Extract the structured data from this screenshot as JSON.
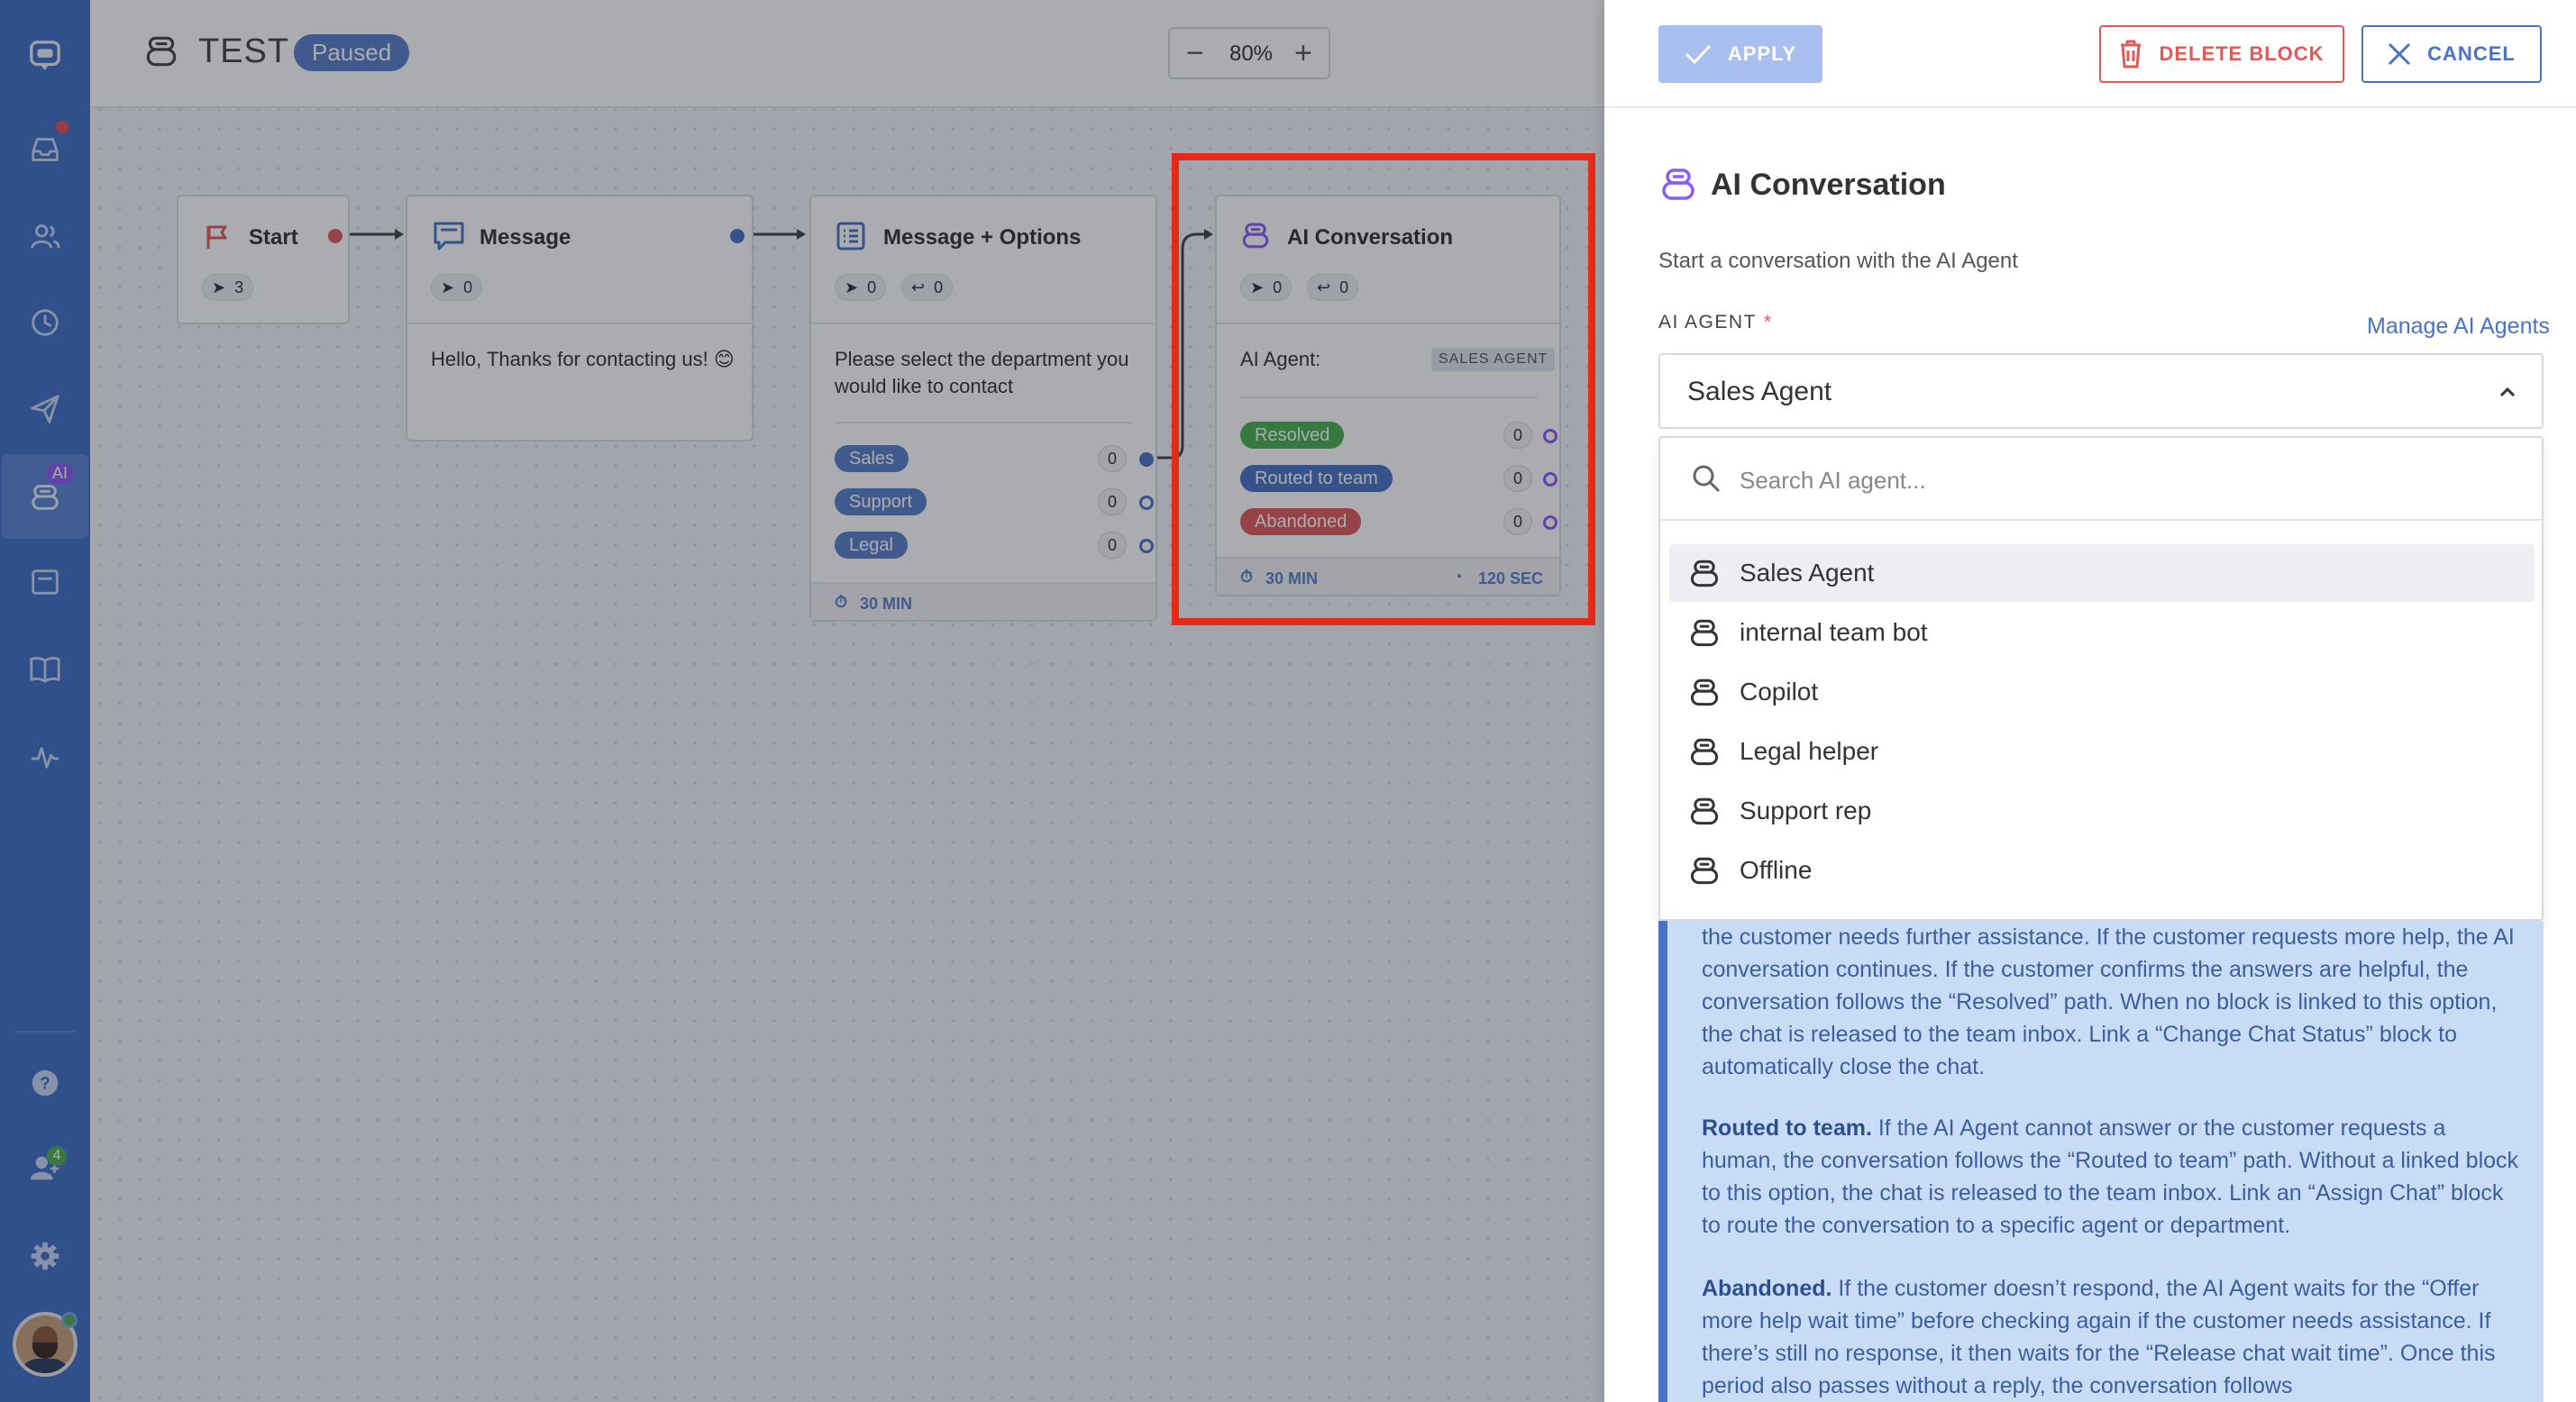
{
  "topbar": {
    "flow_name": "TEST",
    "status": "Paused",
    "zoom": "80%",
    "zoom_out": "−",
    "zoom_in": "+"
  },
  "sidebar": {
    "ai_badge": "AI",
    "team_badge": "4"
  },
  "nodes": {
    "start": {
      "title": "Start",
      "sent": "3"
    },
    "message": {
      "title": "Message",
      "sent": "0",
      "body": "Hello, Thanks for contacting us! 😊"
    },
    "options": {
      "title": "Message + Options",
      "sent": "0",
      "replies": "0",
      "body": "Please select the department you would like to contact",
      "options": [
        {
          "label": "Sales",
          "count": "0",
          "color": "#5b7fc9"
        },
        {
          "label": "Support",
          "count": "0",
          "color": "#5b7fc9"
        },
        {
          "label": "Legal",
          "count": "0",
          "color": "#5b7fc9"
        }
      ],
      "footer": "30 MIN"
    },
    "ai": {
      "title": "AI Conversation",
      "sent": "0",
      "replies": "0",
      "agent_label": "AI Agent:",
      "agent_tag": "SALES AGENT",
      "outcomes": [
        {
          "label": "Resolved",
          "count": "0",
          "color": "#4caf50"
        },
        {
          "label": "Routed to team",
          "count": "0",
          "color": "#4a72c6"
        },
        {
          "label": "Abandoned",
          "count": "0",
          "color": "#e05a5a"
        }
      ],
      "footer_left": "30 MIN",
      "footer_right": "120 SEC"
    }
  },
  "panel": {
    "apply": "APPLY",
    "delete": "DELETE BLOCK",
    "cancel": "CANCEL",
    "title": "AI Conversation",
    "subtitle": "Start a conversation with the AI Agent",
    "field_label": "AI AGENT",
    "required_mark": "*",
    "manage_link": "Manage AI Agents",
    "selected": "Sales Agent",
    "search_placeholder": "Search AI agent...",
    "agents": [
      "Sales Agent",
      "internal team bot",
      "Copilot",
      "Legal helper",
      "Support rep",
      "Offline"
    ],
    "info": {
      "p1": "the customer needs further assistance. If the customer requests more help, the AI conversation continues. If the customer confirms the answers are helpful, the conversation follows the “Resolved” path. When no block is linked to this option, the chat is released to the team inbox. Link a “Change Chat Status” block to automatically close the chat.",
      "p2_title": "Routed to team.",
      "p2": " If the AI Agent cannot answer or the customer requests a human, the conversation follows the “Routed to team” path. Without a linked block to this option, the chat is released to the team inbox. Link an “Assign Chat” block to route the conversation to a specific agent or department.",
      "p3_title": "Abandoned.",
      "p3": " If the customer doesn’t respond, the AI Agent waits for the “Offer more help wait time” before checking again if the customer needs assistance. If there’s still no response, it then waits for the “Release chat wait time”. Once this period also passes without a reply, the conversation follows"
    }
  },
  "colors": {
    "sidebar": "#3f6fc4",
    "accent": "#4a72c6",
    "danger": "#e05a5a",
    "highlight": "#e52a1a",
    "ai_purple": "#8b5cf6"
  }
}
